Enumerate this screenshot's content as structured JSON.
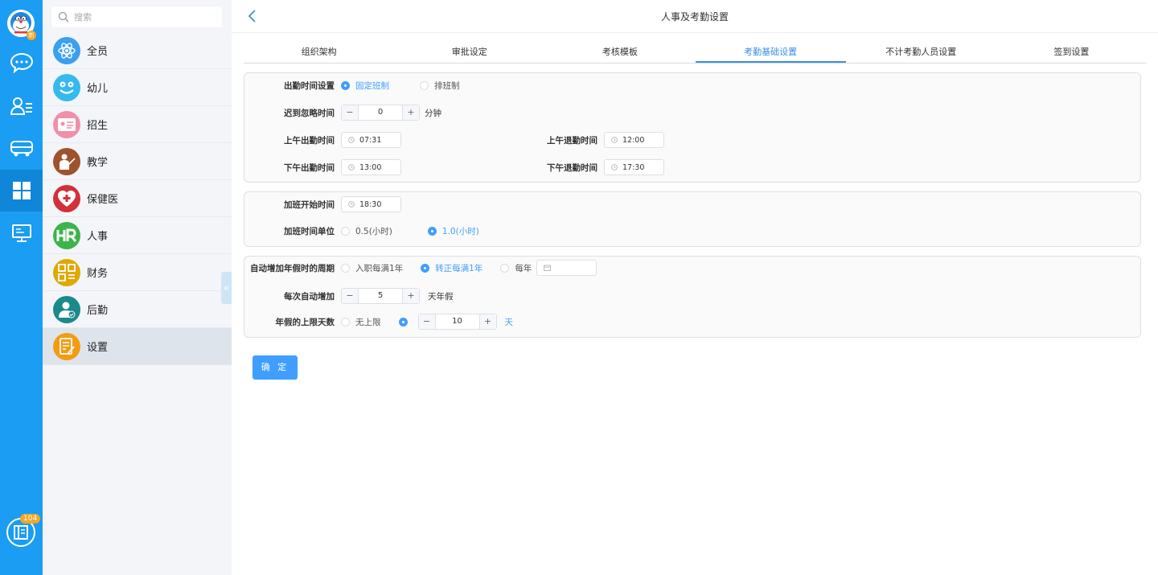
{
  "rail": {
    "avatar_badge": "新",
    "bottom_badge": "104"
  },
  "sidebar": {
    "search_placeholder": "搜索",
    "items": [
      {
        "label": "全员",
        "icon": "atom-icon",
        "color": "#3aa0f0"
      },
      {
        "label": "幼儿",
        "icon": "smile-icon",
        "color": "#35b9ef"
      },
      {
        "label": "招生",
        "icon": "id-card-icon",
        "color": "#f08fa8"
      },
      {
        "label": "教学",
        "icon": "teacher-icon",
        "color": "#a0522d"
      },
      {
        "label": "保健医",
        "icon": "medical-cross-icon",
        "color": "#d3303a"
      },
      {
        "label": "人事",
        "icon": "hr-icon",
        "color": "#3cb44b"
      },
      {
        "label": "财务",
        "icon": "finance-grid-icon",
        "color": "#e0a800"
      },
      {
        "label": "后勤",
        "icon": "user-check-icon",
        "color": "#1a8a8a"
      },
      {
        "label": "设置",
        "icon": "settings-note-icon",
        "color": "#f39c12"
      }
    ],
    "collapse_glyph": "«"
  },
  "main": {
    "title": "人事及考勤设置",
    "tabs": [
      "组织架构",
      "审批设定",
      "考核模板",
      "考勤基础设置",
      "不计考勤人员设置",
      "签到设置"
    ],
    "active_tab": 3,
    "panel1": {
      "attendance_setting_label": "出勤时间设置",
      "opt_fixed": "固定班制",
      "opt_schedule": "排班制",
      "late_ignore_label": "迟到忽略时间",
      "late_ignore_value": "0",
      "late_ignore_unit": "分钟",
      "am_in_label": "上午出勤时间",
      "am_in_value": "07:31",
      "am_out_label": "上午退勤时间",
      "am_out_value": "12:00",
      "pm_in_label": "下午出勤时间",
      "pm_in_value": "13:00",
      "pm_out_label": "下午退勤时间",
      "pm_out_value": "17:30"
    },
    "panel2": {
      "ot_start_label": "加班开始时间",
      "ot_start_value": "18:30",
      "ot_unit_label": "加班时间单位",
      "opt_half": "0.5(小时)",
      "opt_one": "1.0(小时)"
    },
    "panel3": {
      "auto_cycle_label": "自动增加年假时的周期",
      "opt_join": "入职每满1年",
      "opt_regular": "转正每满1年",
      "opt_yearly": "每年",
      "auto_add_label": "每次自动增加",
      "auto_add_value": "5",
      "auto_add_unit": "天年假",
      "limit_label": "年假的上限天数",
      "opt_unlimited": "无上限",
      "limit_value": "10",
      "limit_unit": "天"
    },
    "confirm_label": "确 定",
    "stepper_minus": "−",
    "stepper_plus": "+"
  }
}
